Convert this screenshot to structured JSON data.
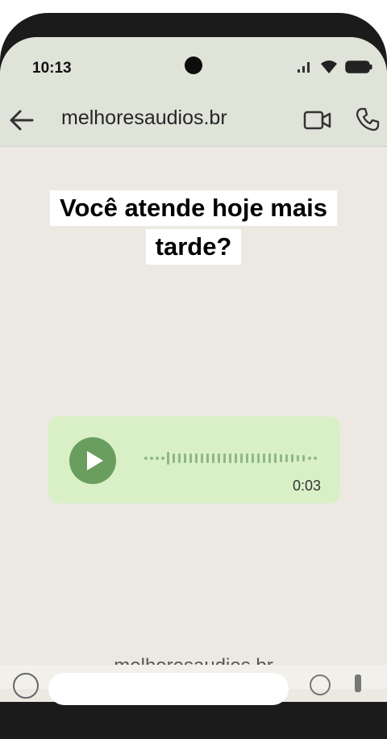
{
  "status_bar": {
    "time": "10:13"
  },
  "header": {
    "title": "melhoresaudios.br"
  },
  "caption": {
    "line1": "Você atende hoje mais",
    "line2": "tarde?"
  },
  "voice_message": {
    "duration": "0:03"
  },
  "footer": {
    "watermark": "melhoresaudios.br"
  },
  "colors": {
    "header_bg": "#dfe3d8",
    "chat_bg": "#ece9e2",
    "bubble_bg": "#d9f0c7",
    "play_button": "#6a9e5f"
  },
  "icons": [
    "back-arrow-icon",
    "video-call-icon",
    "phone-call-icon",
    "play-icon",
    "signal-icon",
    "wifi-icon",
    "battery-icon"
  ]
}
